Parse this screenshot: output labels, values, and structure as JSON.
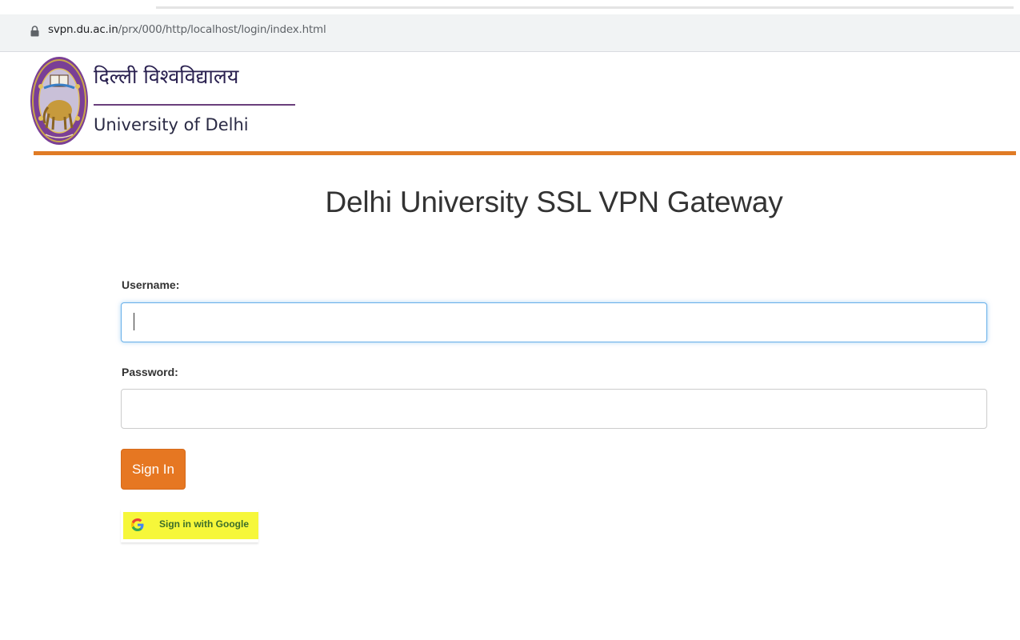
{
  "browser": {
    "url_domain": "svpn.du.ac.in",
    "url_path": "/prx/000/http/localhost/login/index.html"
  },
  "header": {
    "hindi_name": "दिल्ली विश्वविद्यालय",
    "english_name": "University of Delhi"
  },
  "main": {
    "title": "Delhi University SSL VPN Gateway",
    "username_label": "Username:",
    "username_value": "",
    "password_label": "Password:",
    "password_value": "",
    "signin_label": "Sign In",
    "google_signin_label": "Sign in with Google"
  },
  "colors": {
    "accent_orange": "#e67722",
    "header_rule": "#e07b25",
    "google_highlight": "#f6f73a",
    "focus_border": "#66afe9"
  },
  "icons": {
    "address_bar": "lock-icon",
    "header_logo": "university-emblem",
    "google_button": "google-g-icon"
  }
}
